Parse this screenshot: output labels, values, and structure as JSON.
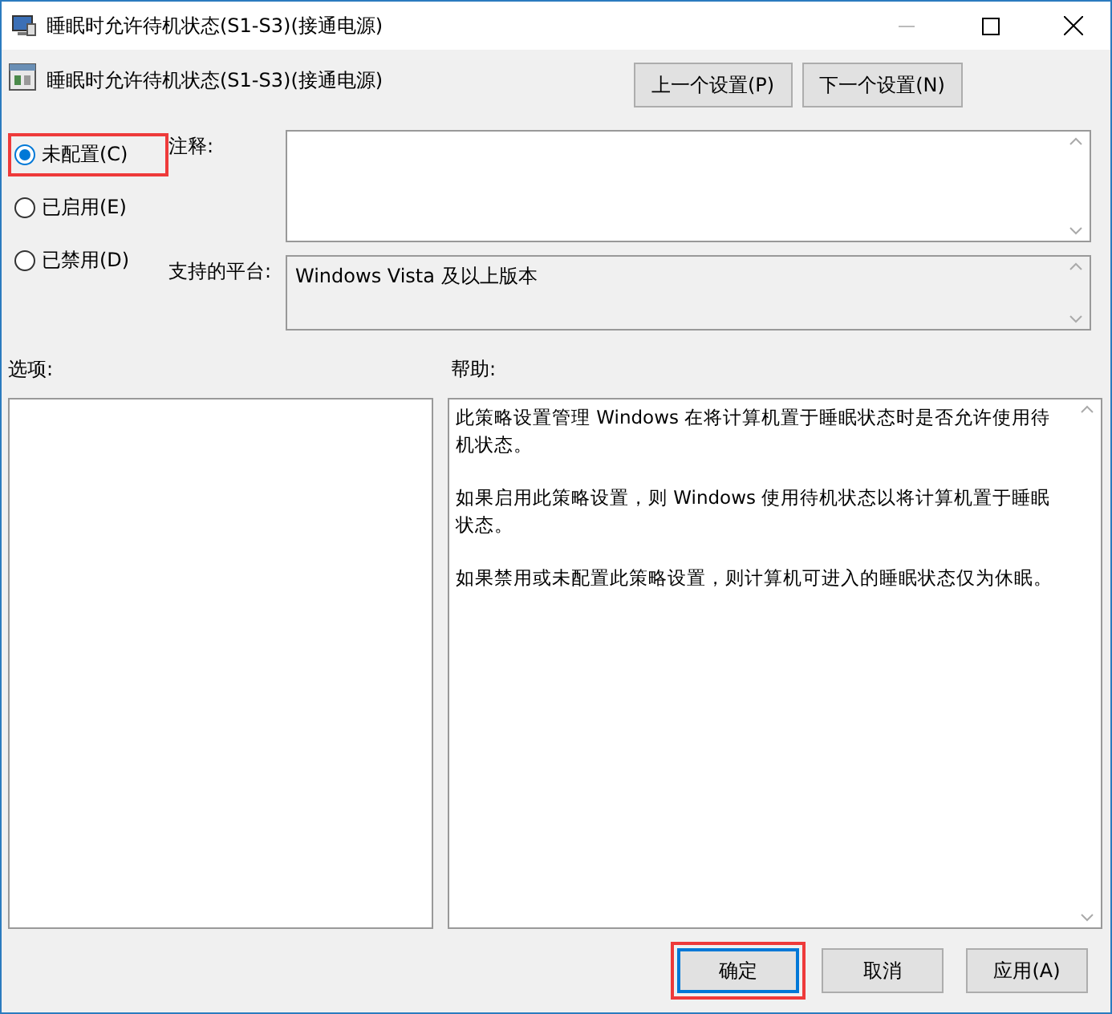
{
  "window": {
    "title": "睡眠时允许待机状态(S1-S3)(接通电源)"
  },
  "header": {
    "title": "睡眠时允许待机状态(S1-S3)(接通电源)",
    "nav_buttons": [
      "上一个设置(P)",
      "下一个设置(N)"
    ]
  },
  "options": [
    {
      "label": "未配置(C)",
      "selected": true,
      "highlighted": true
    },
    {
      "label": "已启用(E)",
      "selected": false,
      "highlighted": false
    },
    {
      "label": "已禁用(D)",
      "selected": false,
      "highlighted": false
    }
  ],
  "comment": {
    "label": "注释:"
  },
  "platform": {
    "label": "支持的平台:",
    "value": "Windows Vista 及以上版本"
  },
  "options_label": "选项:",
  "help": {
    "label": "帮助:",
    "paragraphs": [
      "此策略设置管理 Windows 在将计算机置于睡眠状态时是否允许使用待机状态。",
      "如果启用此策略设置，则 Windows 使用待机状态以将计算机置于睡眠状态。",
      "如果禁用或未配置此策略设置，则计算机可进入的睡眠状态仅为休眠。"
    ]
  },
  "buttons": [
    {
      "label": "确定",
      "default": true,
      "highlighted": true
    },
    {
      "label": "取消",
      "default": false,
      "highlighted": false
    },
    {
      "label": "应用(A)",
      "default": false,
      "highlighted": false
    }
  ]
}
